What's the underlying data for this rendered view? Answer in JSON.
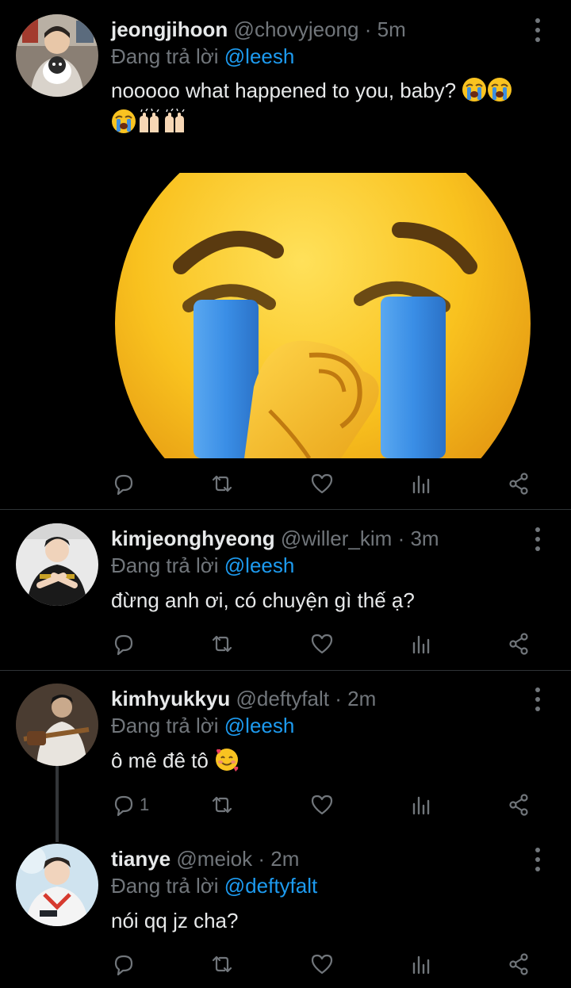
{
  "tweets": [
    {
      "display_name": "jeongjihoon",
      "handle": "@chovyjeong",
      "dot": "·",
      "time": "5m",
      "reply_prefix": "Đang trả lời ",
      "reply_to": "@leesh",
      "text": "nooooo what happened to you, baby?",
      "text_emojis": [
        "loudly-crying-face-emoji",
        "loudly-crying-face-emoji",
        "loudly-crying-face-emoji",
        "raising-hands-emoji",
        "raising-hands-emoji"
      ],
      "media": "loudly-crying-face-emoji-image",
      "reply_count": ""
    },
    {
      "display_name": "kimjeonghyeong",
      "handle": "@willer_kim",
      "dot": "·",
      "time": "3m",
      "reply_prefix": "Đang trả lời ",
      "reply_to": "@leesh",
      "text": "đừng anh ơi, có chuyện gì thế ạ?",
      "reply_count": ""
    },
    {
      "display_name": "kimhyukkyu",
      "handle": "@deftyfalt",
      "dot": "·",
      "time": "2m",
      "reply_prefix": "Đang trả lời ",
      "reply_to": "@leesh",
      "text": "ô mê đê tô",
      "text_emojis": [
        "smiling-face-with-hearts-emoji"
      ],
      "reply_count": "1"
    },
    {
      "display_name": "tianye",
      "handle": "@meiok",
      "dot": "·",
      "time": "2m",
      "reply_prefix": "Đang trả lời ",
      "reply_to": "@deftyfalt",
      "text": "nói qq jz cha?",
      "reply_count": ""
    }
  ],
  "icons": {
    "reply": "reply-icon",
    "retweet": "retweet-icon",
    "like": "heart-icon",
    "views": "views-icon",
    "share": "share-icon",
    "more": "more-vertical-icon"
  },
  "colors": {
    "background": "#000000",
    "text": "#e7e9ea",
    "secondary": "#71767b",
    "accent": "#1d9bf0",
    "divider": "#2f3336"
  }
}
